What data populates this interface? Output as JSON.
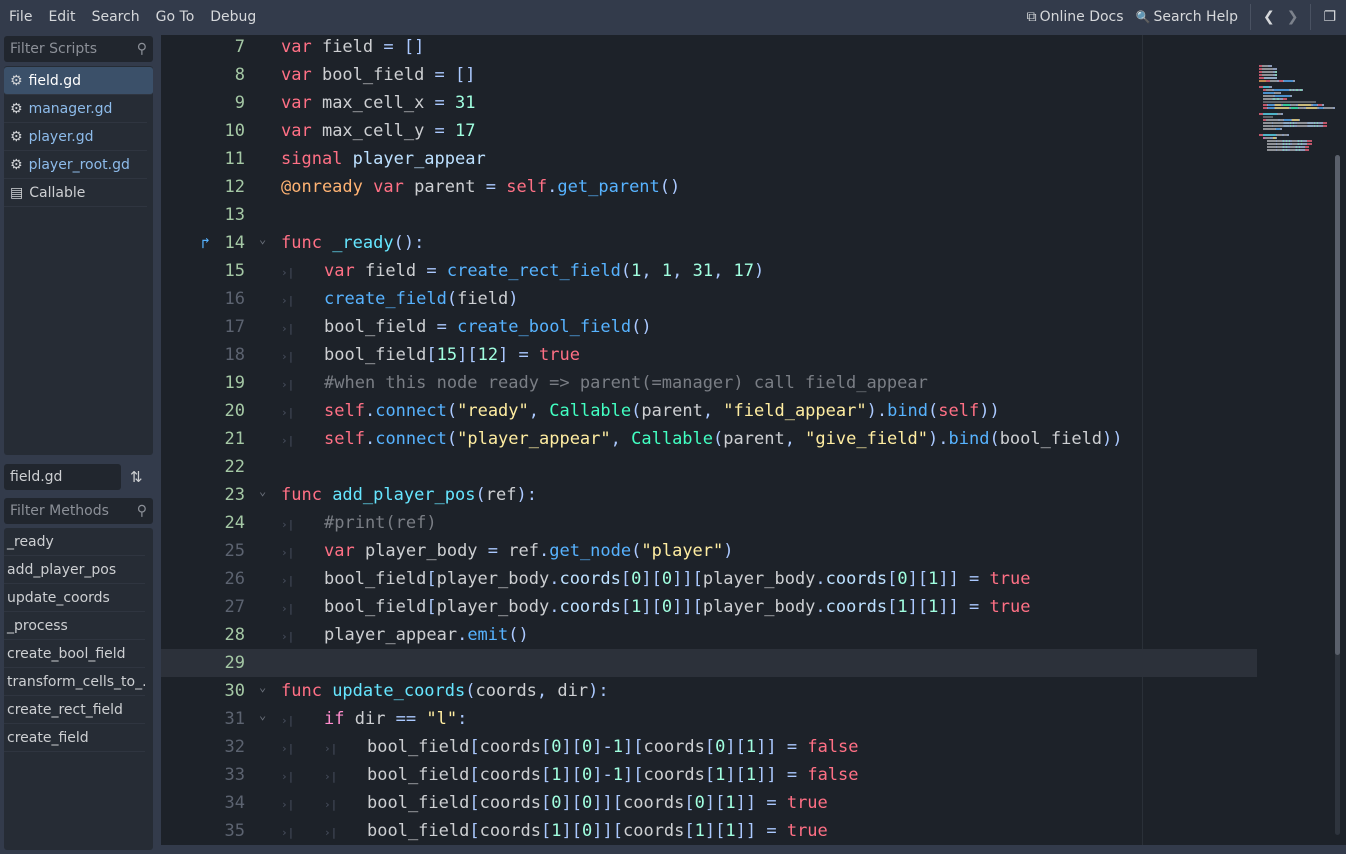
{
  "menu": [
    "File",
    "Edit",
    "Search",
    "Go To",
    "Debug"
  ],
  "toolbar": {
    "online_docs": "Online Docs",
    "search_help": "Search Help"
  },
  "scripts": {
    "filter_placeholder": "Filter Scripts",
    "items": [
      {
        "label": "field.gd",
        "selected": true
      },
      {
        "label": "manager.gd"
      },
      {
        "label": "player.gd"
      },
      {
        "label": "player_root.gd"
      },
      {
        "label": "Callable",
        "doc": true
      }
    ]
  },
  "methods": {
    "current_script": "field.gd",
    "filter_placeholder": "Filter Methods",
    "items": [
      "_ready",
      "add_player_pos",
      "update_coords",
      "_process",
      "create_bool_field",
      "transform_cells_to_...",
      "create_rect_field",
      "create_field"
    ]
  },
  "colors": {
    "keyword": "#ff7085",
    "function": "#57b3ff",
    "string": "#ffeda1",
    "number": "#a1ffe0",
    "type": "#42ffc2"
  },
  "code": {
    "current_line": 29,
    "lines": [
      {
        "n": "7",
        "mod": true,
        "i": 0,
        "t": [
          [
            "kw",
            "var"
          ],
          [
            "tx",
            " field "
          ],
          [
            "sy",
            "= []"
          ]
        ]
      },
      {
        "n": "8",
        "mod": true,
        "i": 0,
        "t": [
          [
            "kw",
            "var"
          ],
          [
            "tx",
            " bool_field "
          ],
          [
            "sy",
            "= []"
          ]
        ]
      },
      {
        "n": "9",
        "mod": true,
        "i": 0,
        "t": [
          [
            "kw",
            "var"
          ],
          [
            "tx",
            " max_cell_x "
          ],
          [
            "sy",
            "= "
          ],
          [
            "nu",
            "31"
          ]
        ]
      },
      {
        "n": "10",
        "mod": true,
        "i": 0,
        "t": [
          [
            "kw",
            "var"
          ],
          [
            "tx",
            " max_cell_y "
          ],
          [
            "sy",
            "= "
          ],
          [
            "nu",
            "17"
          ]
        ]
      },
      {
        "n": "11",
        "mod": true,
        "i": 0,
        "t": [
          [
            "kw",
            "signal"
          ],
          [
            "mb",
            " player_appear"
          ]
        ]
      },
      {
        "n": "12",
        "mod": true,
        "i": 0,
        "t": [
          [
            "an",
            "@onready"
          ],
          [
            "kw",
            " var"
          ],
          [
            "tx",
            " parent "
          ],
          [
            "sy",
            "= "
          ],
          [
            "kw",
            "self"
          ],
          [
            "sy",
            "."
          ],
          [
            "fn",
            "get_parent"
          ],
          [
            "sy",
            "()"
          ]
        ]
      },
      {
        "n": "13",
        "mod": true,
        "i": 0,
        "t": []
      },
      {
        "n": "14",
        "mod": true,
        "i": 0,
        "fold": true,
        "bm": true,
        "t": [
          [
            "kw",
            "func"
          ],
          [
            "fd",
            " _ready"
          ],
          [
            "sy",
            "():"
          ]
        ]
      },
      {
        "n": "15",
        "mod": true,
        "i": 1,
        "t": [
          [
            "kw",
            "var"
          ],
          [
            "tx",
            " field "
          ],
          [
            "sy",
            "= "
          ],
          [
            "fn",
            "create_rect_field"
          ],
          [
            "sy",
            "("
          ],
          [
            "nu",
            "1"
          ],
          [
            "sy",
            ", "
          ],
          [
            "nu",
            "1"
          ],
          [
            "sy",
            ", "
          ],
          [
            "nu",
            "31"
          ],
          [
            "sy",
            ", "
          ],
          [
            "nu",
            "17"
          ],
          [
            "sy",
            ")"
          ]
        ]
      },
      {
        "n": "16",
        "mod": false,
        "i": 1,
        "t": [
          [
            "fn",
            "create_field"
          ],
          [
            "sy",
            "("
          ],
          [
            "tx",
            "field"
          ],
          [
            "sy",
            ")"
          ]
        ]
      },
      {
        "n": "17",
        "mod": false,
        "i": 1,
        "t": [
          [
            "tx",
            "bool_field "
          ],
          [
            "sy",
            "= "
          ],
          [
            "fn",
            "create_bool_field"
          ],
          [
            "sy",
            "()"
          ]
        ]
      },
      {
        "n": "18",
        "mod": false,
        "i": 1,
        "t": [
          [
            "tx",
            "bool_field"
          ],
          [
            "sy",
            "["
          ],
          [
            "nu",
            "15"
          ],
          [
            "sy",
            "]["
          ],
          [
            "nu",
            "12"
          ],
          [
            "sy",
            "] = "
          ],
          [
            "kw",
            "true"
          ]
        ]
      },
      {
        "n": "19",
        "mod": true,
        "i": 1,
        "t": [
          [
            "cm",
            "#when this node ready => parent(=manager) call field_appear"
          ]
        ]
      },
      {
        "n": "20",
        "mod": true,
        "i": 1,
        "t": [
          [
            "kw",
            "self"
          ],
          [
            "sy",
            "."
          ],
          [
            "fn",
            "connect"
          ],
          [
            "sy",
            "("
          ],
          [
            "st",
            "\"ready\""
          ],
          [
            "sy",
            ", "
          ],
          [
            "ty",
            "Callable"
          ],
          [
            "sy",
            "("
          ],
          [
            "tx",
            "parent"
          ],
          [
            "sy",
            ", "
          ],
          [
            "st",
            "\"field_appear\""
          ],
          [
            "sy",
            ")."
          ],
          [
            "fn",
            "bind"
          ],
          [
            "sy",
            "("
          ],
          [
            "kw",
            "self"
          ],
          [
            "sy",
            "))"
          ]
        ]
      },
      {
        "n": "21",
        "mod": true,
        "i": 1,
        "t": [
          [
            "kw",
            "self"
          ],
          [
            "sy",
            "."
          ],
          [
            "fn",
            "connect"
          ],
          [
            "sy",
            "("
          ],
          [
            "st",
            "\"player_appear\""
          ],
          [
            "sy",
            ", "
          ],
          [
            "ty",
            "Callable"
          ],
          [
            "sy",
            "("
          ],
          [
            "tx",
            "parent"
          ],
          [
            "sy",
            ", "
          ],
          [
            "st",
            "\"give_field\""
          ],
          [
            "sy",
            ")."
          ],
          [
            "fn",
            "bind"
          ],
          [
            "sy",
            "("
          ],
          [
            "tx",
            "bool_field"
          ],
          [
            "sy",
            "))"
          ]
        ]
      },
      {
        "n": "22",
        "mod": true,
        "i": 0,
        "t": []
      },
      {
        "n": "23",
        "mod": true,
        "i": 0,
        "fold": true,
        "t": [
          [
            "kw",
            "func"
          ],
          [
            "fd",
            " add_player_pos"
          ],
          [
            "sy",
            "("
          ],
          [
            "tx",
            "ref"
          ],
          [
            "sy",
            "):"
          ]
        ]
      },
      {
        "n": "24",
        "mod": true,
        "i": 1,
        "t": [
          [
            "cm",
            "#print(ref)"
          ]
        ]
      },
      {
        "n": "25",
        "mod": false,
        "i": 1,
        "t": [
          [
            "kw",
            "var"
          ],
          [
            "tx",
            " player_body "
          ],
          [
            "sy",
            "= "
          ],
          [
            "tx",
            "ref"
          ],
          [
            "sy",
            "."
          ],
          [
            "fn",
            "get_node"
          ],
          [
            "sy",
            "("
          ],
          [
            "st",
            "\"player\""
          ],
          [
            "sy",
            ")"
          ]
        ]
      },
      {
        "n": "26",
        "mod": false,
        "i": 1,
        "t": [
          [
            "tx",
            "bool_field"
          ],
          [
            "sy",
            "["
          ],
          [
            "tx",
            "player_body"
          ],
          [
            "sy",
            "."
          ],
          [
            "mb",
            "coords"
          ],
          [
            "sy",
            "["
          ],
          [
            "nu",
            "0"
          ],
          [
            "sy",
            "]["
          ],
          [
            "nu",
            "0"
          ],
          [
            "sy",
            "]]["
          ],
          [
            "tx",
            "player_body"
          ],
          [
            "sy",
            "."
          ],
          [
            "mb",
            "coords"
          ],
          [
            "sy",
            "["
          ],
          [
            "nu",
            "0"
          ],
          [
            "sy",
            "]["
          ],
          [
            "nu",
            "1"
          ],
          [
            "sy",
            "]] = "
          ],
          [
            "kw",
            "true"
          ]
        ]
      },
      {
        "n": "27",
        "mod": false,
        "i": 1,
        "t": [
          [
            "tx",
            "bool_field"
          ],
          [
            "sy",
            "["
          ],
          [
            "tx",
            "player_body"
          ],
          [
            "sy",
            "."
          ],
          [
            "mb",
            "coords"
          ],
          [
            "sy",
            "["
          ],
          [
            "nu",
            "1"
          ],
          [
            "sy",
            "]["
          ],
          [
            "nu",
            "0"
          ],
          [
            "sy",
            "]]["
          ],
          [
            "tx",
            "player_body"
          ],
          [
            "sy",
            "."
          ],
          [
            "mb",
            "coords"
          ],
          [
            "sy",
            "["
          ],
          [
            "nu",
            "1"
          ],
          [
            "sy",
            "]["
          ],
          [
            "nu",
            "1"
          ],
          [
            "sy",
            "]] = "
          ],
          [
            "kw",
            "true"
          ]
        ]
      },
      {
        "n": "28",
        "mod": true,
        "i": 1,
        "t": [
          [
            "tx",
            "player_appear"
          ],
          [
            "sy",
            "."
          ],
          [
            "fn",
            "emit"
          ],
          [
            "sy",
            "()"
          ]
        ]
      },
      {
        "n": "29",
        "mod": true,
        "i": 0,
        "t": []
      },
      {
        "n": "30",
        "mod": true,
        "i": 0,
        "fold": true,
        "t": [
          [
            "kw",
            "func"
          ],
          [
            "fd",
            " update_coords"
          ],
          [
            "sy",
            "("
          ],
          [
            "tx",
            "coords"
          ],
          [
            "sy",
            ", "
          ],
          [
            "tx",
            "dir"
          ],
          [
            "sy",
            "):"
          ]
        ]
      },
      {
        "n": "31",
        "mod": false,
        "i": 1,
        "fold": true,
        "t": [
          [
            "cf",
            "if"
          ],
          [
            "tx",
            " dir "
          ],
          [
            "sy",
            "== "
          ],
          [
            "st",
            "\"l\""
          ],
          [
            "sy",
            ":"
          ]
        ]
      },
      {
        "n": "32",
        "mod": false,
        "i": 2,
        "t": [
          [
            "tx",
            "bool_field"
          ],
          [
            "sy",
            "["
          ],
          [
            "tx",
            "coords"
          ],
          [
            "sy",
            "["
          ],
          [
            "nu",
            "0"
          ],
          [
            "sy",
            "]["
          ],
          [
            "nu",
            "0"
          ],
          [
            "sy",
            "]-"
          ],
          [
            "nu",
            "1"
          ],
          [
            "sy",
            "]["
          ],
          [
            "tx",
            "coords"
          ],
          [
            "sy",
            "["
          ],
          [
            "nu",
            "0"
          ],
          [
            "sy",
            "]["
          ],
          [
            "nu",
            "1"
          ],
          [
            "sy",
            "]] = "
          ],
          [
            "kw",
            "false"
          ]
        ]
      },
      {
        "n": "33",
        "mod": false,
        "i": 2,
        "t": [
          [
            "tx",
            "bool_field"
          ],
          [
            "sy",
            "["
          ],
          [
            "tx",
            "coords"
          ],
          [
            "sy",
            "["
          ],
          [
            "nu",
            "1"
          ],
          [
            "sy",
            "]["
          ],
          [
            "nu",
            "0"
          ],
          [
            "sy",
            "]-"
          ],
          [
            "nu",
            "1"
          ],
          [
            "sy",
            "]["
          ],
          [
            "tx",
            "coords"
          ],
          [
            "sy",
            "["
          ],
          [
            "nu",
            "1"
          ],
          [
            "sy",
            "]["
          ],
          [
            "nu",
            "1"
          ],
          [
            "sy",
            "]] = "
          ],
          [
            "kw",
            "false"
          ]
        ]
      },
      {
        "n": "34",
        "mod": false,
        "i": 2,
        "t": [
          [
            "tx",
            "bool_field"
          ],
          [
            "sy",
            "["
          ],
          [
            "tx",
            "coords"
          ],
          [
            "sy",
            "["
          ],
          [
            "nu",
            "0"
          ],
          [
            "sy",
            "]["
          ],
          [
            "nu",
            "0"
          ],
          [
            "sy",
            "]]["
          ],
          [
            "tx",
            "coords"
          ],
          [
            "sy",
            "["
          ],
          [
            "nu",
            "0"
          ],
          [
            "sy",
            "]["
          ],
          [
            "nu",
            "1"
          ],
          [
            "sy",
            "]] = "
          ],
          [
            "kw",
            "true"
          ]
        ]
      },
      {
        "n": "35",
        "mod": false,
        "i": 2,
        "t": [
          [
            "tx",
            "bool_field"
          ],
          [
            "sy",
            "["
          ],
          [
            "tx",
            "coords"
          ],
          [
            "sy",
            "["
          ],
          [
            "nu",
            "1"
          ],
          [
            "sy",
            "]["
          ],
          [
            "nu",
            "0"
          ],
          [
            "sy",
            "]]["
          ],
          [
            "tx",
            "coords"
          ],
          [
            "sy",
            "["
          ],
          [
            "nu",
            "1"
          ],
          [
            "sy",
            "]["
          ],
          [
            "nu",
            "1"
          ],
          [
            "sy",
            "]] = "
          ],
          [
            "kw",
            "true"
          ]
        ]
      }
    ]
  }
}
